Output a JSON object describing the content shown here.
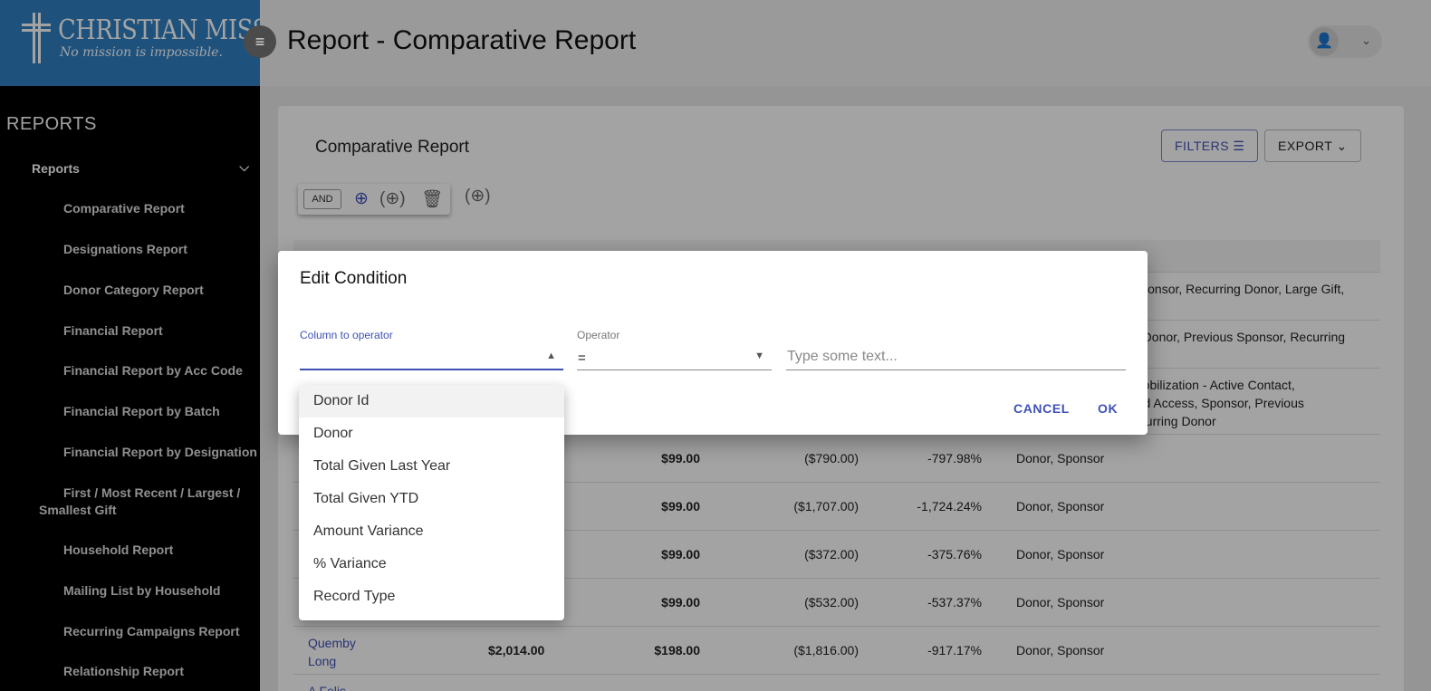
{
  "logo": {
    "title": "CHRISTIAN MISSION",
    "tagline": "No mission is impossible."
  },
  "sidebar": {
    "section_title": "REPORTS",
    "group_label": "Reports",
    "items": [
      "Comparative Report",
      "Designations Report",
      "Donor Category Report",
      "Financial Report",
      "Financial Report by Acc Code",
      "Financial Report by Batch",
      "Financial Report by Designation",
      "First / Most Recent / Largest / Smallest Gift",
      "Household Report",
      "Mailing List by Household",
      "Recurring Campaigns Report",
      "Relationship Report"
    ]
  },
  "header": {
    "title": "Report - Comparative Report"
  },
  "card": {
    "title": "Comparative Report",
    "filters_label": "FILTERS",
    "export_label": "EXPORT",
    "and_label": "AND"
  },
  "table_rows": [
    {
      "type": "Sponsor, Recurring Donor, Large Gift,"
    },
    {
      "type": "e Donor, Previous Sponsor, Recurring"
    },
    {
      "type_lines": [
        "Mobilization - Active Contact,",
        "ard Access, Sponsor, Previous",
        "ecurring Donor"
      ]
    },
    {
      "ytd": "$99.00",
      "variance": "($790.00)",
      "pct": "-797.98%",
      "type": "Donor, Sponsor"
    },
    {
      "ytd": "$99.00",
      "variance": "($1,707.00)",
      "pct": "-1,724.24%",
      "type": "Donor, Sponsor"
    },
    {
      "ytd": "$99.00",
      "variance": "($372.00)",
      "pct": "-375.76%",
      "type": "Donor, Sponsor"
    },
    {
      "ytd": "$99.00",
      "variance": "($532.00)",
      "pct": "-537.37%",
      "type": "Donor, Sponsor"
    },
    {
      "name": "Quemby Long",
      "last": "$2,014.00",
      "ytd": "$198.00",
      "variance": "($1,816.00)",
      "pct": "-917.17%",
      "type": "Donor, Sponsor"
    },
    {
      "name": "A Felis"
    }
  ],
  "dialog": {
    "title": "Edit Condition",
    "column_label": "Column to operator",
    "operator_label": "Operator",
    "operator_value": "=",
    "text_placeholder": "Type some text...",
    "cancel_label": "CANCEL",
    "ok_label": "OK"
  },
  "column_options": [
    "Donor Id",
    "Donor",
    "Total Given Last Year",
    "Total Given YTD",
    "Amount Variance",
    "% Variance",
    "Record Type"
  ],
  "colors": {
    "accent": "#3f51b5",
    "sidebar_bg": "#000000",
    "logo_bg": "#2f80c4"
  }
}
